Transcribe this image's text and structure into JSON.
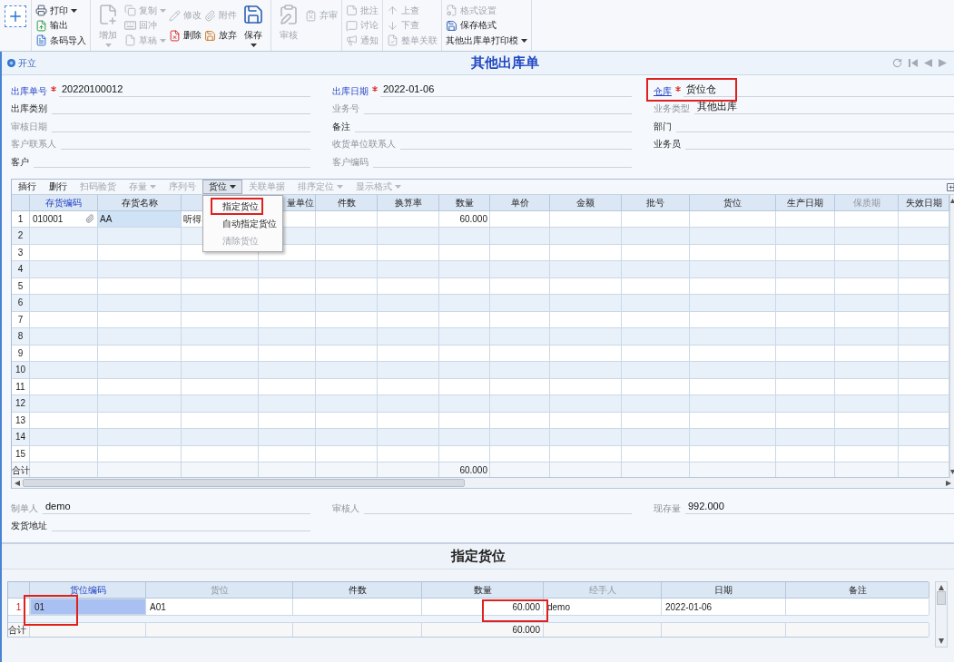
{
  "toolbar": {
    "groups": [
      {
        "columns": [
          {
            "items": [
              {
                "kind": "icon",
                "disabled": false
              }
            ]
          }
        ]
      },
      {
        "columns": [
          {
            "items": [
              {
                "kind": "small",
                "label": "打印",
                "disabled": false,
                "dropdown": true
              },
              {
                "kind": "small",
                "label": "输出",
                "disabled": false,
                "dropdown": false
              },
              {
                "kind": "small",
                "label": "条码导入",
                "disabled": false,
                "dropdown": false
              }
            ]
          }
        ]
      },
      {
        "columns": [
          {
            "items": [
              {
                "kind": "large",
                "label": "增加",
                "disabled": true,
                "dropdown": true
              }
            ]
          },
          {
            "items": [
              {
                "kind": "small",
                "label": "复制",
                "disabled": true,
                "dropdown": true
              },
              {
                "kind": "small",
                "label": "回冲",
                "disabled": true,
                "dropdown": false
              },
              {
                "kind": "small",
                "label": "草稿",
                "disabled": true,
                "dropdown": true
              }
            ]
          },
          {
            "items": [
              {
                "kind": "small",
                "label": "修改",
                "disabled": true,
                "dropdown": false
              },
              {
                "kind": "small",
                "label": "删除",
                "disabled": false,
                "dropdown": false
              }
            ]
          },
          {
            "items": [
              {
                "kind": "small",
                "label": "附件",
                "disabled": true,
                "dropdown": false
              },
              {
                "kind": "small",
                "label": "放弃",
                "disabled": false,
                "dropdown": false
              }
            ]
          },
          {
            "items": [
              {
                "kind": "large",
                "label": "保存",
                "disabled": false,
                "dropdown": true
              }
            ]
          }
        ]
      },
      {
        "columns": [
          {
            "items": [
              {
                "kind": "large",
                "label": "审核",
                "disabled": true,
                "dropdown": false
              }
            ]
          },
          {
            "items": [
              {
                "kind": "small",
                "label": "弃审",
                "disabled": true,
                "dropdown": false
              }
            ]
          }
        ]
      },
      {
        "columns": [
          {
            "items": [
              {
                "kind": "small",
                "label": "批注",
                "disabled": true,
                "dropdown": false
              },
              {
                "kind": "small",
                "label": "讨论",
                "disabled": true,
                "dropdown": false
              },
              {
                "kind": "small",
                "label": "通知",
                "disabled": true,
                "dropdown": false
              }
            ]
          }
        ]
      },
      {
        "columns": [
          {
            "items": [
              {
                "kind": "small",
                "label": "上查",
                "disabled": true,
                "dropdown": false
              },
              {
                "kind": "small",
                "label": "下查",
                "disabled": true,
                "dropdown": false
              },
              {
                "kind": "small",
                "label": "整单关联",
                "disabled": true,
                "dropdown": false
              }
            ]
          }
        ]
      },
      {
        "columns": [
          {
            "items": [
              {
                "kind": "small",
                "label": "格式设置",
                "disabled": true,
                "dropdown": false
              },
              {
                "kind": "small",
                "label": "保存格式",
                "disabled": false,
                "dropdown": false
              },
              {
                "kind": "menu",
                "label": "其他出库单打印模",
                "disabled": false,
                "dropdown": true
              }
            ]
          }
        ]
      }
    ]
  },
  "status": {
    "label": "开立"
  },
  "title": "其他出库单",
  "header_fields": [
    {
      "label": "出库单号",
      "value": "20220100012",
      "required": true,
      "link": false,
      "disabled": false,
      "highlighted": false
    },
    {
      "label": "出库日期",
      "value": "2022-01-06",
      "required": true,
      "link": false,
      "disabled": false,
      "highlighted": false
    },
    {
      "label": "仓库",
      "value": "货位仓",
      "required": true,
      "link": true,
      "disabled": false,
      "highlighted": true
    },
    {
      "label": "出库类别",
      "required": false,
      "link": false,
      "disabled": false,
      "highlighted": false
    },
    {
      "label": "业务号",
      "required": false,
      "link": false,
      "disabled": true,
      "highlighted": false
    },
    {
      "label": "业务类型",
      "value": "其他出库",
      "required": false,
      "link": false,
      "disabled": true,
      "highlighted": false
    },
    {
      "label": "审核日期",
      "required": false,
      "link": false,
      "disabled": true,
      "highlighted": false
    },
    {
      "label": "备注",
      "required": false,
      "link": false,
      "disabled": false,
      "highlighted": false
    },
    {
      "label": "部门",
      "required": false,
      "link": false,
      "disabled": false,
      "highlighted": false
    },
    {
      "label": "客户联系人",
      "required": false,
      "link": false,
      "disabled": true,
      "highlighted": false
    },
    {
      "label": "收货单位联系人",
      "required": false,
      "link": false,
      "disabled": true,
      "highlighted": false
    },
    {
      "label": "业务员",
      "required": false,
      "link": false,
      "disabled": false,
      "highlighted": false
    },
    {
      "label": "客户",
      "required": false,
      "link": false,
      "disabled": false,
      "highlighted": false
    },
    {
      "label": "客户编码",
      "required": false,
      "link": false,
      "disabled": true,
      "highlighted": false
    }
  ],
  "grid": {
    "toolbar": [
      {
        "label": "插行",
        "disabled": false,
        "dropdown": false,
        "expanded": false
      },
      {
        "label": "删行",
        "disabled": false,
        "dropdown": false,
        "expanded": false
      },
      {
        "label": "扫码验货",
        "disabled": true,
        "dropdown": false,
        "expanded": false
      },
      {
        "label": "存量",
        "disabled": true,
        "dropdown": true,
        "expanded": false
      },
      {
        "label": "序列号",
        "disabled": true,
        "dropdown": false,
        "expanded": false
      },
      {
        "label": "货位",
        "disabled": false,
        "dropdown": true,
        "expanded": true
      },
      {
        "label": "关联单据",
        "disabled": true,
        "dropdown": false,
        "expanded": false
      },
      {
        "label": "排序定位",
        "disabled": true,
        "dropdown": true,
        "expanded": false
      },
      {
        "label": "显示格式",
        "disabled": true,
        "dropdown": true,
        "expanded": false
      }
    ],
    "menu": {
      "items": [
        {
          "label": "指定货位",
          "disabled": false,
          "highlighted": true
        },
        {
          "label": "自动指定货位",
          "disabled": false,
          "highlighted": false
        },
        {
          "label": "清除货位",
          "disabled": true,
          "highlighted": false
        }
      ]
    },
    "columns": [
      {
        "kind": "text",
        "label": "存货编码",
        "required": true,
        "disabled": false
      },
      {
        "kind": "text",
        "label": "存货名称",
        "required": false,
        "disabled": false
      },
      {
        "kind": "covered"
      },
      {
        "kind": "text",
        "label": "量单位",
        "required": false,
        "disabled": false
      },
      {
        "kind": "text",
        "label": "件数",
        "required": false,
        "disabled": false
      },
      {
        "kind": "text",
        "label": "换算率",
        "required": false,
        "disabled": false
      },
      {
        "kind": "text",
        "label": "数量",
        "required": false,
        "disabled": false
      },
      {
        "kind": "text",
        "label": "单价",
        "required": false,
        "disabled": false
      },
      {
        "kind": "text",
        "label": "金额",
        "required": false,
        "disabled": false
      },
      {
        "kind": "text",
        "label": "批号",
        "required": false,
        "disabled": false
      },
      {
        "kind": "text",
        "label": "货位",
        "required": false,
        "disabled": false
      },
      {
        "kind": "text",
        "label": "生产日期",
        "required": false,
        "disabled": false
      },
      {
        "kind": "text",
        "label": "保质期",
        "required": false,
        "disabled": true
      },
      {
        "kind": "text",
        "label": "失效日期",
        "required": false,
        "disabled": false
      }
    ],
    "rows": [
      {
        "number": "1",
        "item_code": {
          "text": "010001",
          "attachment": true,
          "selected": false
        },
        "item_name": {
          "text": "AA",
          "selected": true
        },
        "column_3": {
          "text": "听得",
          "selected": false
        },
        "quantity": {
          "text": "60.000",
          "selected": false
        }
      },
      {
        "number": "2"
      },
      {
        "number": "3"
      },
      {
        "number": "4"
      },
      {
        "number": "5"
      },
      {
        "number": "6"
      },
      {
        "number": "7"
      },
      {
        "number": "8"
      },
      {
        "number": "9"
      },
      {
        "number": "10"
      },
      {
        "number": "11"
      },
      {
        "number": "12"
      },
      {
        "number": "13"
      },
      {
        "number": "14"
      },
      {
        "number": "15"
      }
    ],
    "total": {
      "label": "合计",
      "quantity": {
        "text": "60.000"
      }
    }
  },
  "footer_fields": [
    {
      "label": "制单人",
      "value": "demo",
      "disabled": true
    },
    {
      "label": "审核人",
      "disabled": true
    },
    {
      "label": "现存量",
      "value": "992.000",
      "disabled": true
    },
    {
      "label": "发货地址",
      "disabled": false
    }
  ],
  "assign_panel": {
    "title": "指定货位",
    "columns": [
      {
        "label": "货位编码",
        "required": true,
        "disabled": false
      },
      {
        "label": "货位",
        "required": false,
        "disabled": true
      },
      {
        "label": "件数",
        "required": false,
        "disabled": false
      },
      {
        "label": "数量",
        "required": false,
        "disabled": false
      },
      {
        "label": "经手人",
        "required": false,
        "disabled": true
      },
      {
        "label": "日期",
        "required": false,
        "disabled": false
      },
      {
        "label": "备注",
        "required": false,
        "disabled": false
      }
    ],
    "rows": [
      {
        "number": "1",
        "current": true,
        "location_code": {
          "text": "01",
          "selected": true,
          "highlighted": true
        },
        "location": {
          "text": "A01",
          "selected": false,
          "highlighted": false
        },
        "quantity": {
          "text": "60.000",
          "selected": false,
          "highlighted": true
        },
        "handler": {
          "text": "demo",
          "selected": false,
          "highlighted": false
        },
        "date": {
          "text": "2022-01-06",
          "selected": false,
          "highlighted": false
        }
      }
    ],
    "total": {
      "label": "合计",
      "quantity": {
        "text": "60.000"
      }
    }
  }
}
